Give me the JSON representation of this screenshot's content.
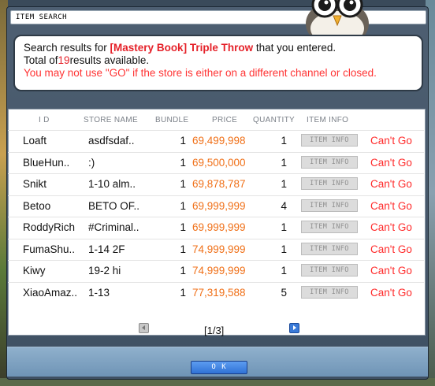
{
  "window": {
    "title": "ITEM SEARCH"
  },
  "info": {
    "line1_prefix": "Search results for ",
    "search_term": "[Mastery Book] Triple Throw",
    "line1_suffix": " that you entered.",
    "line2_prefix": "Total of",
    "total_count": "19",
    "line2_suffix": "results available.",
    "warning": "You may not use \"GO\" if the store is either on a different channel or closed."
  },
  "columns": {
    "id": "I D",
    "store_name": "STORE NAME",
    "bundle": "BUNDLE",
    "price": "PRICE",
    "quantity": "QUANTITY",
    "item_info": "ITEM INFO"
  },
  "rows": [
    {
      "id": "Loaft",
      "store": "asdfsdaf..",
      "bundle": "1",
      "price": "69,499,998",
      "qty": "1",
      "info": "ITEM INFO",
      "go": "Can't Go"
    },
    {
      "id": "BlueHun..",
      "store": ":)",
      "bundle": "1",
      "price": "69,500,000",
      "qty": "1",
      "info": "ITEM INFO",
      "go": "Can't Go"
    },
    {
      "id": "Snikt",
      "store": "1-10 alm..",
      "bundle": "1",
      "price": "69,878,787",
      "qty": "1",
      "info": "ITEM INFO",
      "go": "Can't Go"
    },
    {
      "id": "Betoo",
      "store": "BETO OF..",
      "bundle": "1",
      "price": "69,999,999",
      "qty": "4",
      "info": "ITEM INFO",
      "go": "Can't Go"
    },
    {
      "id": "RoddyRich",
      "store": "#Criminal..",
      "bundle": "1",
      "price": "69,999,999",
      "qty": "1",
      "info": "ITEM INFO",
      "go": "Can't Go"
    },
    {
      "id": "FumaShu..",
      "store": "1-14 2F",
      "bundle": "1",
      "price": "74,999,999",
      "qty": "1",
      "info": "ITEM INFO",
      "go": "Can't Go"
    },
    {
      "id": "Kiwy",
      "store": "19-2 hi",
      "bundle": "1",
      "price": "74,999,999",
      "qty": "1",
      "info": "ITEM INFO",
      "go": "Can't Go"
    },
    {
      "id": "XiaoAmaz..",
      "store": "1-13",
      "bundle": "1",
      "price": "77,319,588",
      "qty": "5",
      "info": "ITEM INFO",
      "go": "Can't Go"
    }
  ],
  "pagination": {
    "label": "[1/3]"
  },
  "footer": {
    "ok_label": "O K"
  },
  "colors": {
    "price": "#f07018",
    "cant_go": "#ff2a2a",
    "highlight": "#e5222a",
    "ok_button": "#2f72d6"
  }
}
